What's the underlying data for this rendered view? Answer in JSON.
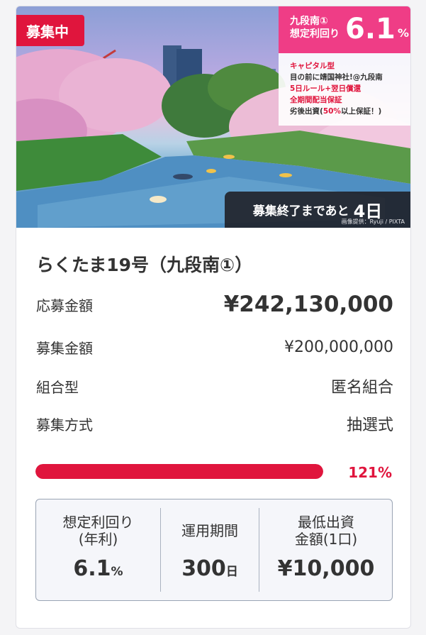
{
  "hero": {
    "status_badge": "募集中",
    "yield_name_line1": "九段南①",
    "yield_name_line2": "想定利回り",
    "yield_value": "6.1",
    "yield_unit": "%",
    "features": [
      {
        "text": "キャピタル型",
        "style": "red"
      },
      {
        "text": "目の前に靖国神社!@九段南",
        "style": "dark"
      },
      {
        "text": "5日ルール+翌日償還",
        "style": "red"
      },
      {
        "text": "全期間配当保証",
        "style": "red"
      }
    ],
    "feature_last_prefix": "劣後出資(",
    "feature_last_highlight": "50%",
    "feature_last_suffix": "以上保証！)",
    "countdown_label": "募集終了まであと",
    "countdown_value": "4日",
    "credit": "画像提供：Ryuji / PIXTA"
  },
  "fund": {
    "title": "らくたま19号（九段南①）",
    "rows": [
      {
        "key": "応募金額",
        "value": "¥242,130,000"
      },
      {
        "key": "募集金額",
        "value": "¥200,000,000"
      },
      {
        "key": "組合型",
        "value": "匿名組合"
      },
      {
        "key": "募集方式",
        "value": "抽選式"
      }
    ],
    "progress_percent": 121,
    "progress_text": "121%"
  },
  "stats": [
    {
      "label_line1": "想定利回り",
      "label_line2": "(年利)",
      "value": "6.1",
      "unit": "%"
    },
    {
      "label_line1": "運用期間",
      "label_line2": "",
      "value": "300",
      "unit": "日"
    },
    {
      "label_line1": "最低出資",
      "label_line2": "金額(1口)",
      "value": "¥10,000",
      "unit": ""
    }
  ],
  "colors": {
    "accent": "#e0153d",
    "yield_bg": "#ef3d86",
    "stats_bg": "#f5f6fa"
  }
}
